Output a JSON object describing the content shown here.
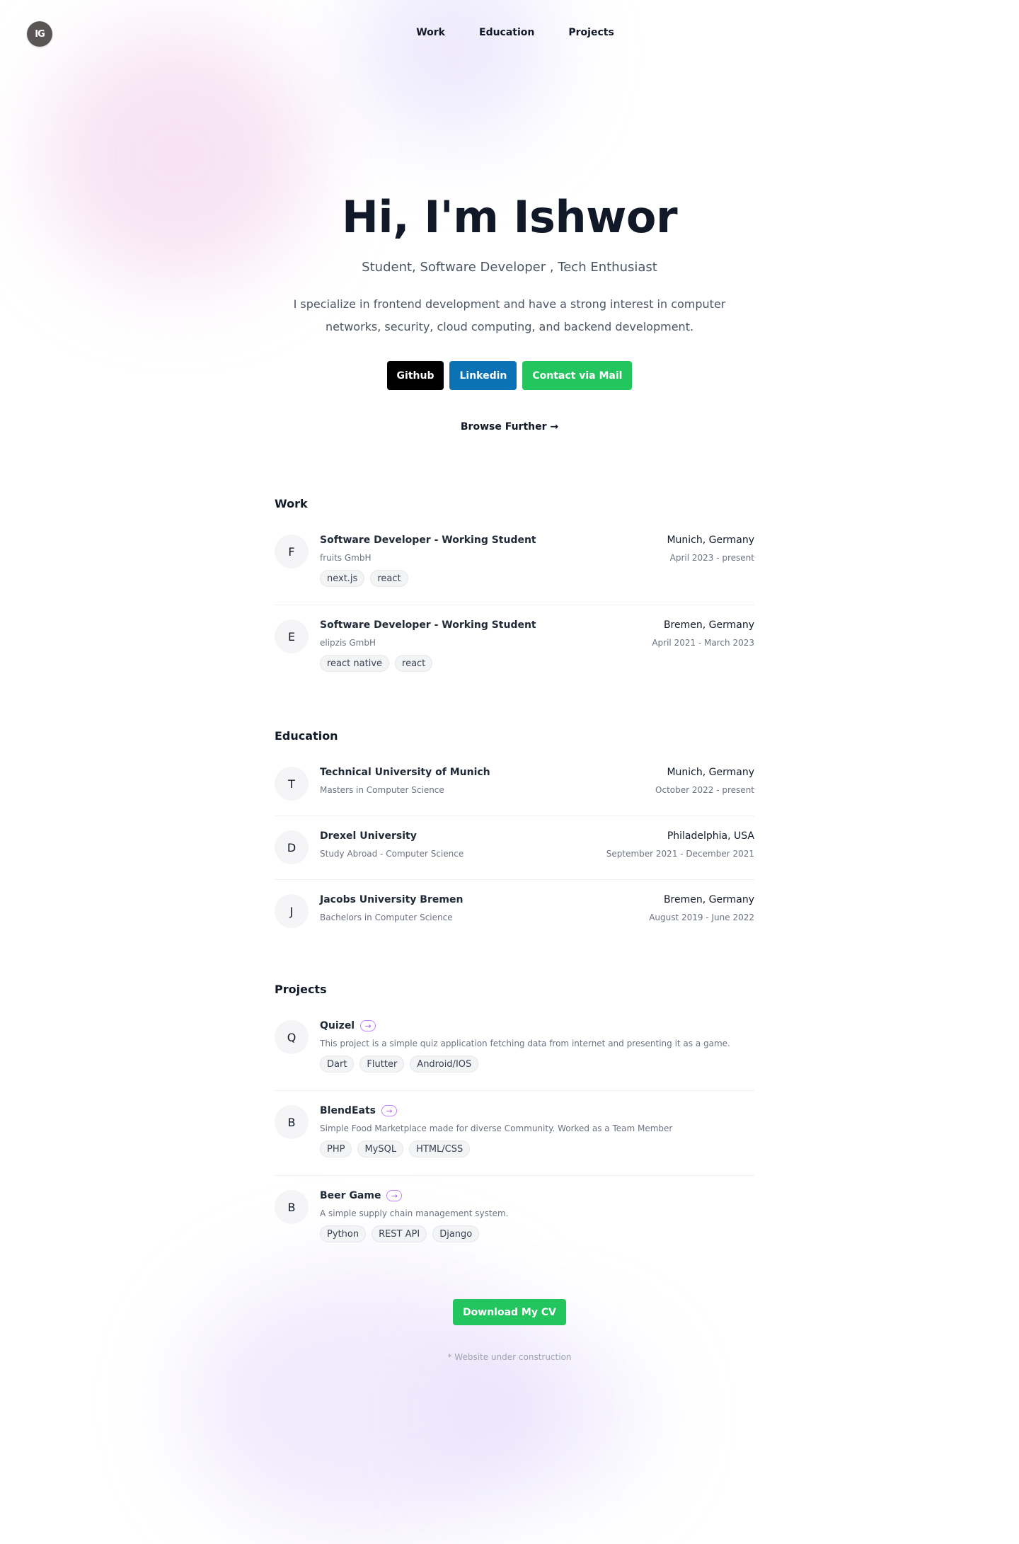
{
  "logo": {
    "text": "IG"
  },
  "nav": [
    {
      "label": "Work"
    },
    {
      "label": "Education"
    },
    {
      "label": "Projects"
    }
  ],
  "hero": {
    "title": "Hi, I'm Ishwor",
    "subtitle": "Student, Software Developer , Tech Enthusiast",
    "description": "I specialize in frontend development and have a strong interest in computer networks, security, cloud computing, and backend development.",
    "buttons": {
      "github": "Github",
      "linkedin": "Linkedin",
      "mail": "Contact via Mail"
    },
    "browse": "Browse Further →"
  },
  "work": {
    "title": "Work",
    "items": [
      {
        "initial": "F",
        "role": "Software Developer - Working Student",
        "company": "fruits GmbH",
        "location": "Munich, Germany",
        "date": "April 2023 - present",
        "tags": [
          "next.js",
          "react"
        ]
      },
      {
        "initial": "E",
        "role": "Software Developer - Working Student",
        "company": "elipzis GmbH",
        "location": "Bremen, Germany",
        "date": "April 2021 - March 2023",
        "tags": [
          "react native",
          "react"
        ]
      }
    ]
  },
  "education": {
    "title": "Education",
    "items": [
      {
        "initial": "T",
        "school": "Technical University of Munich",
        "degree": "Masters in Computer Science",
        "location": "Munich, Germany",
        "date": "October 2022 - present"
      },
      {
        "initial": "D",
        "school": "Drexel University",
        "degree": "Study Abroad - Computer Science",
        "location": "Philadelphia, USA",
        "date": "September 2021 - December 2021"
      },
      {
        "initial": "J",
        "school": "Jacobs University Bremen",
        "degree": "Bachelors in Computer Science",
        "location": "Bremen, Germany",
        "date": "August 2019 - June 2022"
      }
    ]
  },
  "projects": {
    "title": "Projects",
    "arrow": "→",
    "items": [
      {
        "initial": "Q",
        "name": "Quizel",
        "description": "This project is a simple quiz application fetching data from internet and presenting it as a game.",
        "tags": [
          "Dart",
          "Flutter",
          "Android/IOS"
        ]
      },
      {
        "initial": "B",
        "name": "BlendEats",
        "description": "Simple Food Marketplace made for diverse Community. Worked as a Team Member",
        "tags": [
          "PHP",
          "MySQL",
          "HTML/CSS"
        ]
      },
      {
        "initial": "B",
        "name": "Beer Game",
        "description": "A simple supply chain management system.",
        "tags": [
          "Python",
          "REST API",
          "Django"
        ]
      }
    ]
  },
  "footer": {
    "cv_button": "Download My CV",
    "note": "* Website under construction"
  },
  "colors": {
    "github": "#000000",
    "linkedin": "#0a72b5",
    "mail": "#22c55e",
    "accent_purple": "#a855f7"
  }
}
